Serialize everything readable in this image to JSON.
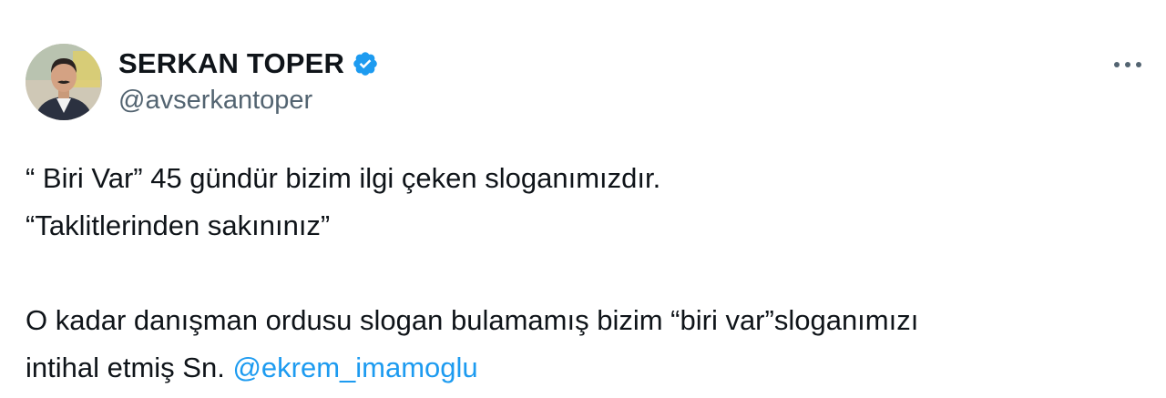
{
  "author": {
    "display_name": "SERKAN TOPER",
    "handle": "@avserkantoper",
    "verified": true,
    "verified_color": "#1d9bf0"
  },
  "menu": {
    "icon": "more-horizontal-icon"
  },
  "tweet": {
    "line1": "“ Biri Var” 45 gündür bizim ilgi çeken sloganımızdır.",
    "line2": "“Taklitlerinden sakınınız”",
    "line3": "O kadar danışman ordusu slogan bulamamış bizim “biri var”sloganımızı",
    "line4_text": "intihal etmiş Sn. ",
    "line4_mention": "@ekrem_imamoglu"
  },
  "colors": {
    "text": "#0f1419",
    "secondary": "#536471",
    "link": "#1d9bf0"
  }
}
